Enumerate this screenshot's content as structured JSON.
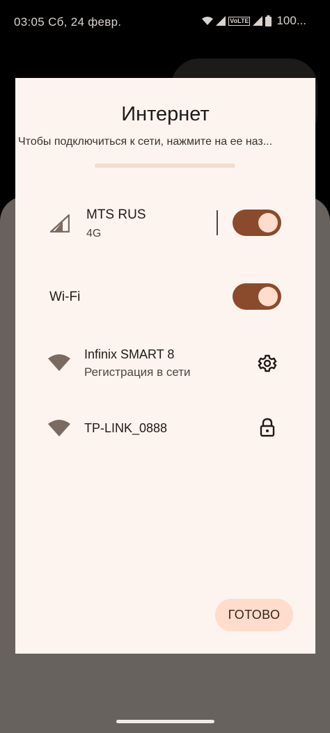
{
  "status_bar": {
    "time": "03:05 Сб, 24 февр.",
    "volte_label": "VoLTE",
    "battery": "100..."
  },
  "dialog": {
    "title": "Интернет",
    "subtitle": "Чтобы подключиться к сети, нажмите на ее наз..."
  },
  "mobile": {
    "name": "MTS RUS",
    "type": "4G",
    "enabled": true
  },
  "wifi": {
    "label": "Wi-Fi",
    "enabled": true
  },
  "networks": [
    {
      "name": "Infinix SMART 8",
      "status": "Регистрация в сети",
      "action_icon": "gear-icon"
    },
    {
      "name": "TP-LINK_0888",
      "status": "",
      "action_icon": "lock-icon"
    }
  ],
  "done_label": "ГОТОВО",
  "colors": {
    "dialog_bg": "#fdf4f0",
    "toggle_track": "#8a4b2c",
    "toggle_knob": "#ffdccb",
    "button_bg": "#ffdccb",
    "backdrop": "#67625e"
  }
}
